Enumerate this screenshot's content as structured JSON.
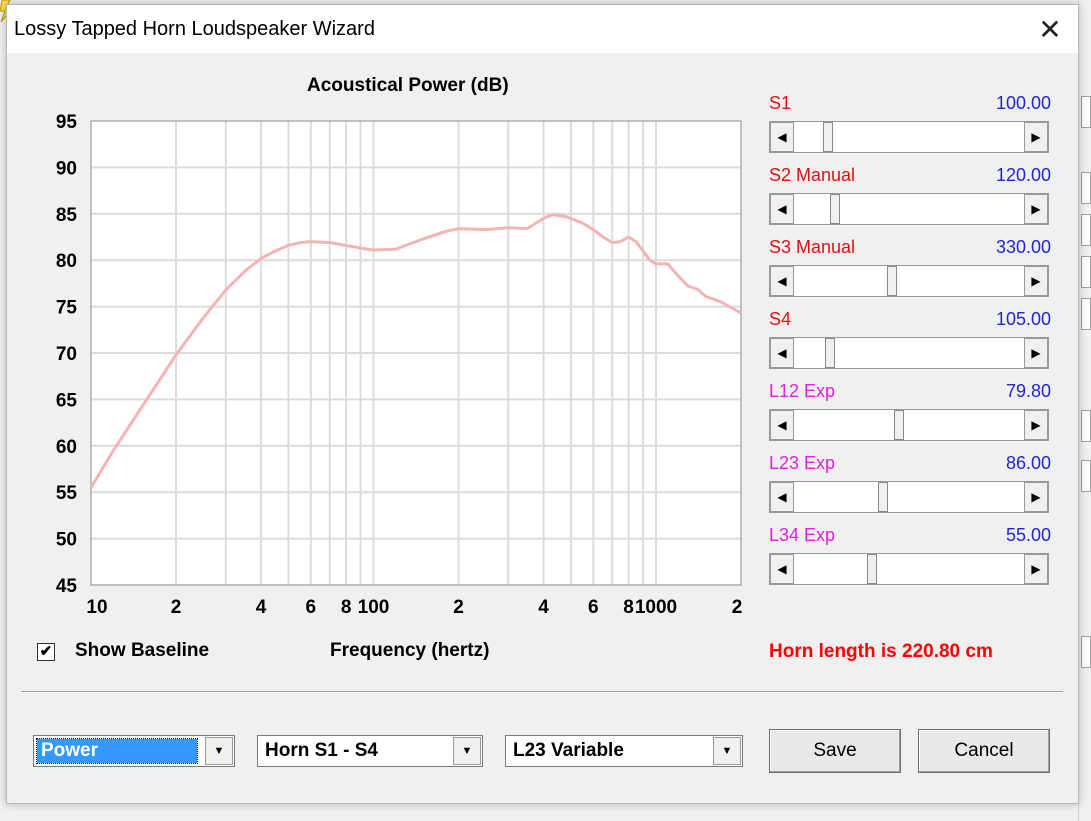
{
  "window": {
    "title": "Lossy Tapped Horn Loudspeaker Wizard",
    "close_glyph": "✕"
  },
  "chart_data": {
    "type": "line",
    "title": "Acoustical Power (dB)",
    "xlabel": "Frequency (hertz)",
    "ylabel": "",
    "xscale": "log",
    "xlim": [
      10,
      2000
    ],
    "ylim": [
      45,
      95
    ],
    "y_ticks": [
      "95",
      "90",
      "85",
      "80",
      "75",
      "70",
      "65",
      "60",
      "55",
      "50",
      "45"
    ],
    "x_tick_labels": [
      "10",
      "2",
      "4",
      "6",
      "8",
      "100",
      "2",
      "4",
      "6",
      "8",
      "1000",
      "2"
    ],
    "grid": true,
    "series": [
      {
        "color": "#f4b4b4",
        "x": [
          10,
          12,
          15,
          20,
          25,
          30,
          35,
          40,
          45,
          50,
          55,
          60,
          70,
          80,
          90,
          100,
          120,
          150,
          180,
          200,
          250,
          300,
          350,
          400,
          430,
          480,
          550,
          600,
          650,
          700,
          750,
          800,
          850,
          900,
          950,
          1000,
          1050,
          1100,
          1200,
          1300,
          1400,
          1500,
          1700,
          2000
        ],
        "y": [
          55.5,
          59.5,
          64.0,
          69.8,
          73.8,
          76.8,
          78.8,
          80.2,
          81.0,
          81.6,
          81.9,
          82.0,
          81.9,
          81.6,
          81.3,
          81.1,
          81.2,
          82.3,
          83.1,
          83.4,
          83.3,
          83.5,
          83.4,
          84.5,
          84.9,
          84.7,
          84.0,
          83.3,
          82.5,
          81.9,
          82.0,
          82.5,
          82.0,
          81.0,
          80.0,
          79.6,
          79.6,
          79.6,
          78.3,
          77.2,
          76.9,
          76.1,
          75.5,
          74.3
        ]
      }
    ]
  },
  "sliders": [
    {
      "label": "S1",
      "value": "100.00",
      "label_color": "#e01010",
      "position": 0.13
    },
    {
      "label": "S2  Manual",
      "value": "120.00",
      "label_color": "#e01010",
      "position": 0.16
    },
    {
      "label": "S3  Manual",
      "value": "330.00",
      "label_color": "#e01010",
      "position": 0.42
    },
    {
      "label": "S4",
      "value": "105.00",
      "label_color": "#e01010",
      "position": 0.14
    },
    {
      "label": "L12  Exp",
      "value": "79.80",
      "label_color": "#e020e0",
      "position": 0.45
    },
    {
      "label": "L23  Exp",
      "value": "86.00",
      "label_color": "#e020e0",
      "position": 0.38
    },
    {
      "label": "L34  Exp",
      "value": "55.00",
      "label_color": "#e020e0",
      "position": 0.33
    }
  ],
  "status": {
    "horn_length": "Horn length is 220.80 cm"
  },
  "baseline": {
    "label": "Show Baseline",
    "checked": true,
    "check_glyph": "✔"
  },
  "combos": {
    "mode": {
      "value": "Power",
      "arrow": "▼"
    },
    "horn": {
      "value": "Horn S1 - S4",
      "arrow": "▼"
    },
    "variable": {
      "value": "L23 Variable",
      "arrow": "▼"
    }
  },
  "buttons": {
    "save": "Save",
    "cancel": "Cancel"
  },
  "scroll_arrows": {
    "left": "◀",
    "right": "▶"
  }
}
